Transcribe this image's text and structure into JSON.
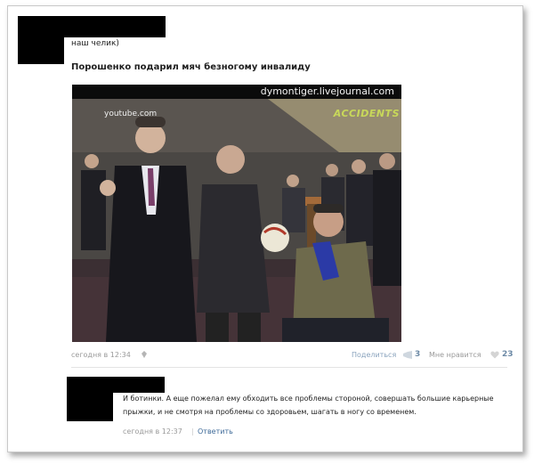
{
  "post": {
    "text": "наш челик)",
    "title": "Порошенко подарил мяч безногому инвалиду",
    "photo": {
      "watermark": "dymontiger.livejournal.com",
      "channel_label": "youtube.com",
      "corner_logo": "ACCIDENTS"
    },
    "timestamp": "сегодня в 12:34",
    "share_label": "Поделиться",
    "share_count": "3",
    "like_label": "Мне нравится",
    "like_count": "23"
  },
  "comment": {
    "text": "И ботинки. А еще пожелал ему обходить все проблемы стороной, совершать большие карьерные прыжки, и не смотря на проблемы со здоровьем, шагать в ногу со временем.",
    "timestamp": "сегодня в 12:37",
    "separator": "|",
    "reply_label": "Ответить"
  }
}
